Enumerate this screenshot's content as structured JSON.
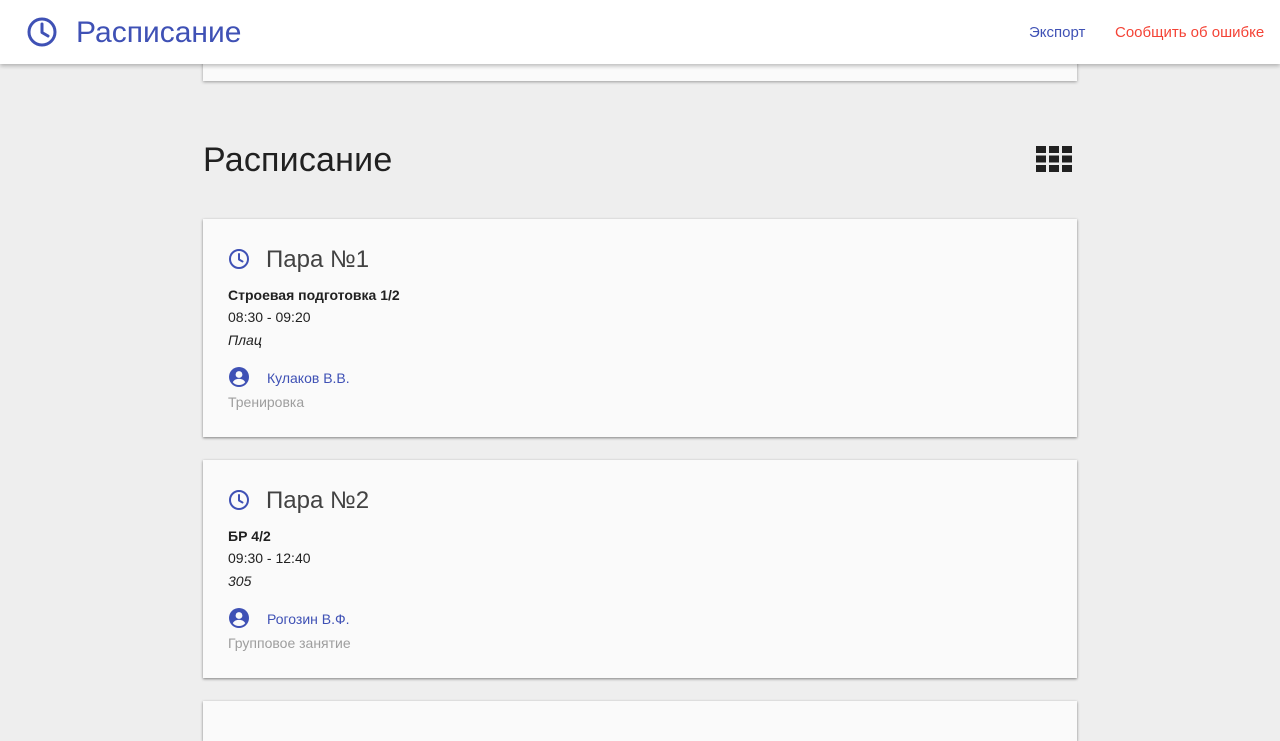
{
  "header": {
    "title": "Расписание",
    "icon": "clock-icon",
    "accent_color": "#3f51b5",
    "export_label": "Экспорт",
    "report_label": "Сообщить об ошибке",
    "report_color": "#f44336"
  },
  "section": {
    "title": "Расписание",
    "view_toggle_icon": "grid-view-icon"
  },
  "lessons": [
    {
      "title": "Пара №1",
      "subject": "Строевая подготовка 1/2",
      "time": "08:30 - 09:20",
      "room": "Плац",
      "teacher": "Кулаков В.В.",
      "kind": "Тренировка"
    },
    {
      "title": "Пара №2",
      "subject": "БР 4/2",
      "time": "09:30 - 12:40",
      "room": "305",
      "teacher": "Рогозин В.Ф.",
      "kind": "Групповое занятие"
    }
  ]
}
